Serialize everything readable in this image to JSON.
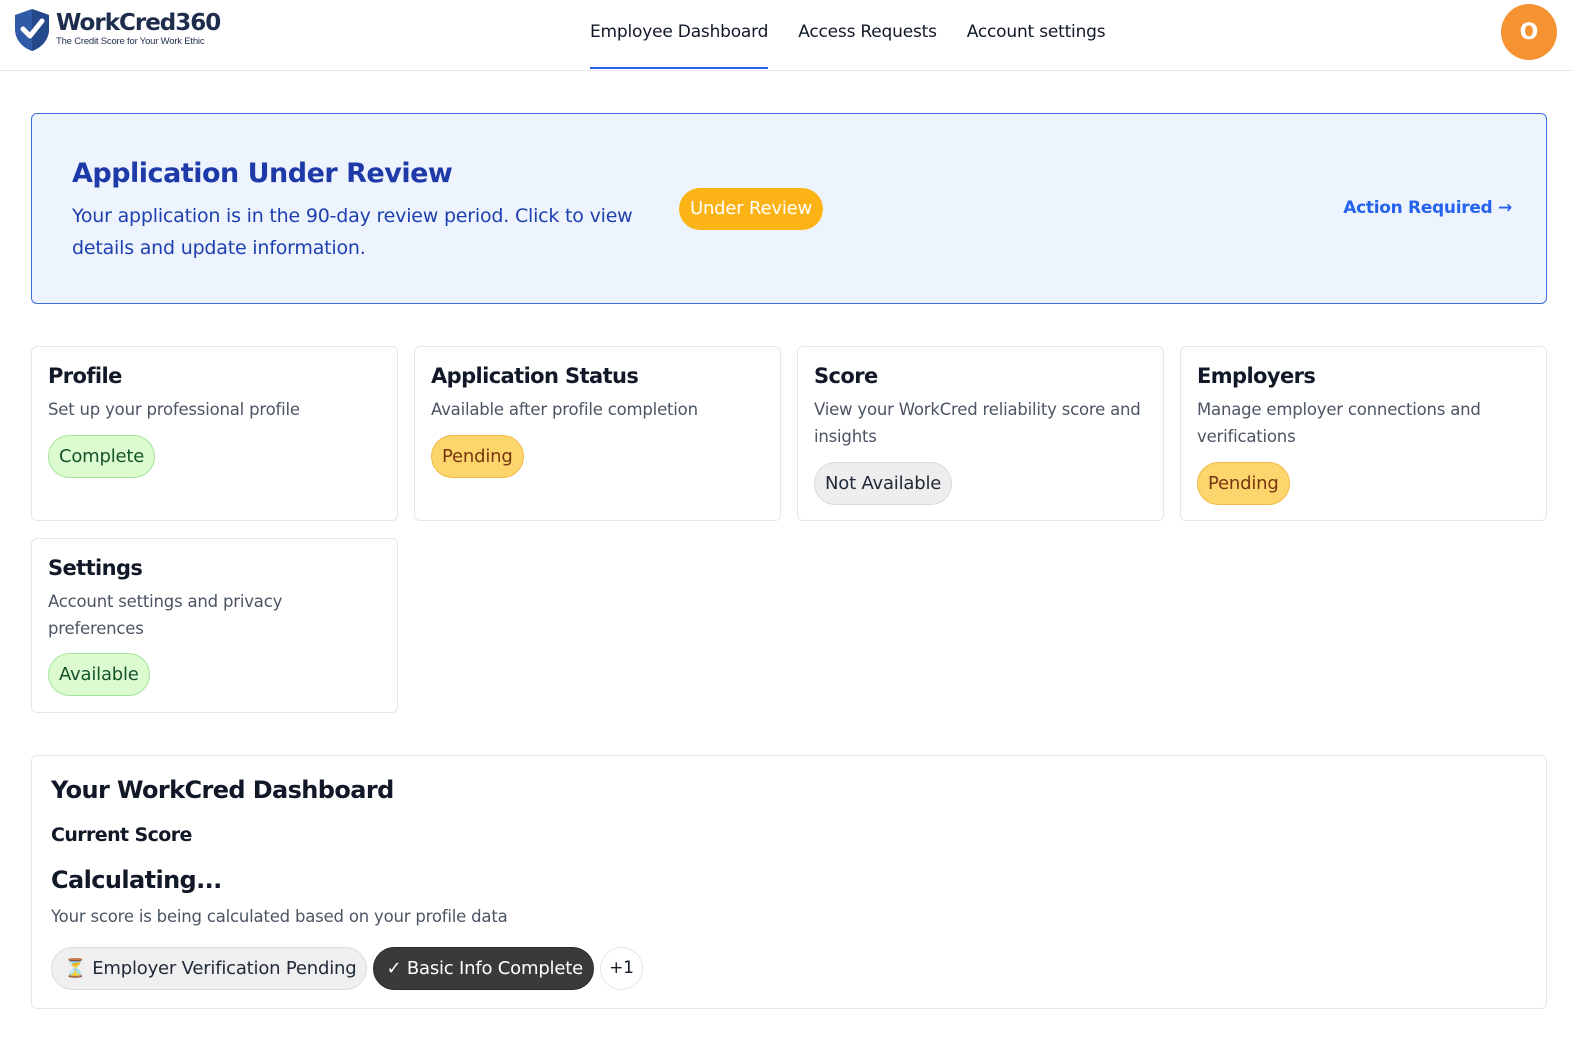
{
  "header": {
    "logo_name": "WorkCred360",
    "logo_tagline": "The Credit Score for Your Work Ethic",
    "nav": [
      {
        "label": "Employee Dashboard",
        "active": true
      },
      {
        "label": "Access Requests",
        "active": false
      },
      {
        "label": "Account settings",
        "active": false
      }
    ],
    "avatar_initial": "O",
    "avatar_color": "#f59332"
  },
  "banner": {
    "title": "Application Under Review",
    "description": "Your application is in the 90-day review period. Click to view details and update information.",
    "badge": "Under Review",
    "action": "Action Required →"
  },
  "cards": [
    {
      "title": "Profile",
      "description": "Set up your professional profile",
      "status": "Complete",
      "status_color": "green"
    },
    {
      "title": "Application Status",
      "description": "Available after profile completion",
      "status": "Pending",
      "status_color": "yellow"
    },
    {
      "title": "Score",
      "description": "View your WorkCred reliability score and insights",
      "status": "Not Available",
      "status_color": "gray"
    },
    {
      "title": "Employers",
      "description": "Manage employer connections and verifications",
      "status": "Pending",
      "status_color": "yellow"
    },
    {
      "title": "Settings",
      "description": "Account settings and privacy preferences",
      "status": "Available",
      "status_color": "green"
    }
  ],
  "dashboard": {
    "title": "Your WorkCred Dashboard",
    "subtitle": "Current Score",
    "value": "Calculating...",
    "note": "Your score is being calculated based on your profile data",
    "chips": [
      {
        "icon": "hourglass-icon",
        "label": "Employer Verification Pending"
      },
      {
        "icon": "check-icon",
        "label": "✓ Basic Info Complete"
      },
      {
        "label": "+1"
      }
    ]
  }
}
